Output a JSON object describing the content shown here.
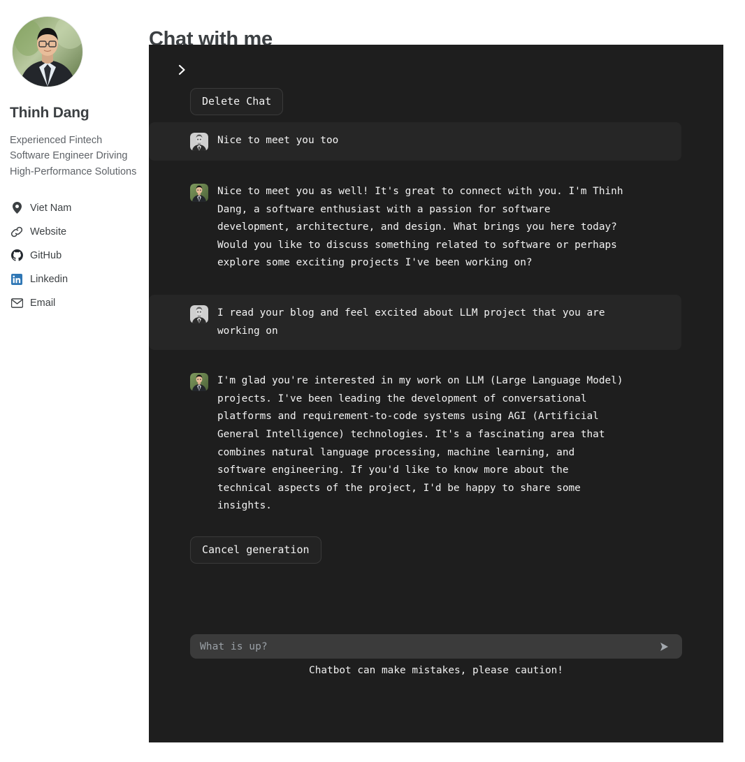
{
  "sidebar": {
    "avatar_alt": "profile-photo",
    "name": "Thinh Dang",
    "tagline": "Experienced Fintech Software Engineer Driving High-Performance Solutions",
    "links": [
      {
        "icon": "location-pin-icon",
        "label": "Viet Nam"
      },
      {
        "icon": "link-icon",
        "label": "Website"
      },
      {
        "icon": "github-icon",
        "label": "GitHub"
      },
      {
        "icon": "linkedin-icon",
        "label": "Linkedin"
      },
      {
        "icon": "email-icon",
        "label": "Email"
      }
    ]
  },
  "main": {
    "page_title": "Chat with me"
  },
  "chat": {
    "toggle_icon": "chevron-right-icon",
    "delete_button_label": "Delete Chat",
    "cancel_button_label": "Cancel generation",
    "messages": [
      {
        "role": "user",
        "avatar": "user-robot-avatar",
        "text": "Nice to meet you too"
      },
      {
        "role": "bot",
        "avatar": "assistant-photo-avatar",
        "text": "Nice to meet you as well! It's great to connect with you. I'm Thinh\nDang, a software enthusiast with a passion for software\ndevelopment, architecture, and design. What brings you here today?\nWould you like to discuss something related to software or perhaps\nexplore some exciting projects I've been working on?"
      },
      {
        "role": "user",
        "avatar": "user-robot-avatar",
        "text": "I read your blog and feel excited about LLM project that you are\nworking on"
      },
      {
        "role": "bot",
        "avatar": "assistant-photo-avatar",
        "text": "I'm glad you're interested in my work on LLM (Large Language Model)\nprojects. I've been leading the development of conversational\nplatforms and requirement-to-code systems using AGI (Artificial\nGeneral Intelligence) technologies. It's a fascinating area that\ncombines natural language processing, machine learning, and\nsoftware engineering. If you'd like to know more about the\ntechnical aspects of the project, I'd be happy to share some\ninsights."
      }
    ],
    "composer": {
      "placeholder": "What is up?",
      "value": "",
      "send_icon": "send-arrow-icon"
    },
    "disclaimer": "Chatbot can make mistakes, please caution!"
  },
  "fab": {
    "icon": "paper-boat-icon",
    "color": "#e8504b"
  },
  "colors": {
    "panel_bg": "#1e1e1e",
    "user_bubble_bg": "#262626",
    "composer_bg": "#3b3b3b",
    "text_light": "#f3f3f3",
    "accent_red": "#e8504b",
    "linkedin_blue": "#2867b2"
  }
}
